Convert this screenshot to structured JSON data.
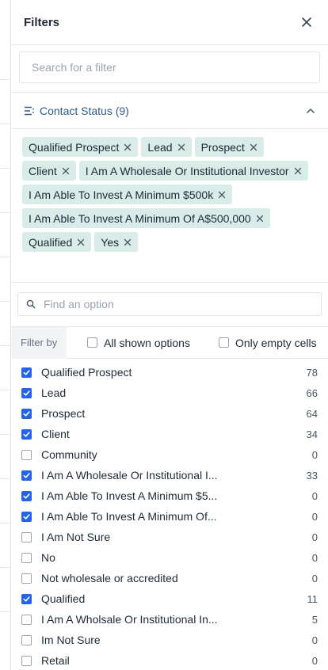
{
  "header": {
    "title": "Filters"
  },
  "search": {
    "placeholder": "Search for a filter"
  },
  "section": {
    "title": "Contact Status (9)"
  },
  "chips": [
    "Qualified Prospect",
    "Lead",
    "Prospect",
    "Client",
    "I Am A Wholesale Or Institutional Investor",
    "I Am Able To Invest A Minimum $500k",
    "I Am Able To Invest A Minimum Of A$500,000",
    "Qualified",
    "Yes"
  ],
  "option_search": {
    "placeholder": "Find an option"
  },
  "filter_bar": {
    "label": "Filter by",
    "all_shown": "All shown options",
    "only_empty": "Only empty cells"
  },
  "options": [
    {
      "label": "Qualified Prospect",
      "count": "78",
      "checked": true
    },
    {
      "label": "Lead",
      "count": "66",
      "checked": true
    },
    {
      "label": "Prospect",
      "count": "64",
      "checked": true
    },
    {
      "label": "Client",
      "count": "34",
      "checked": true
    },
    {
      "label": "Community",
      "count": "0",
      "checked": false
    },
    {
      "label": "I Am A Wholesale Or Institutional I...",
      "count": "33",
      "checked": true
    },
    {
      "label": "I Am Able To Invest A Minimum $5...",
      "count": "0",
      "checked": true
    },
    {
      "label": "I Am Able To Invest A Minimum Of...",
      "count": "0",
      "checked": true
    },
    {
      "label": "I Am Not Sure",
      "count": "0",
      "checked": false
    },
    {
      "label": "No",
      "count": "0",
      "checked": false
    },
    {
      "label": "Not wholesale or accredited",
      "count": "0",
      "checked": false
    },
    {
      "label": "Qualified",
      "count": "11",
      "checked": true
    },
    {
      "label": "I Am A Wholsale Or Institutional In...",
      "count": "5",
      "checked": false
    },
    {
      "label": "Im Not Sure",
      "count": "0",
      "checked": false
    },
    {
      "label": "Retail",
      "count": "0",
      "checked": false
    }
  ],
  "colors": {
    "accent": "#2563eb",
    "chip_bg": "#d9ece8",
    "section_title": "#2c5b87"
  }
}
